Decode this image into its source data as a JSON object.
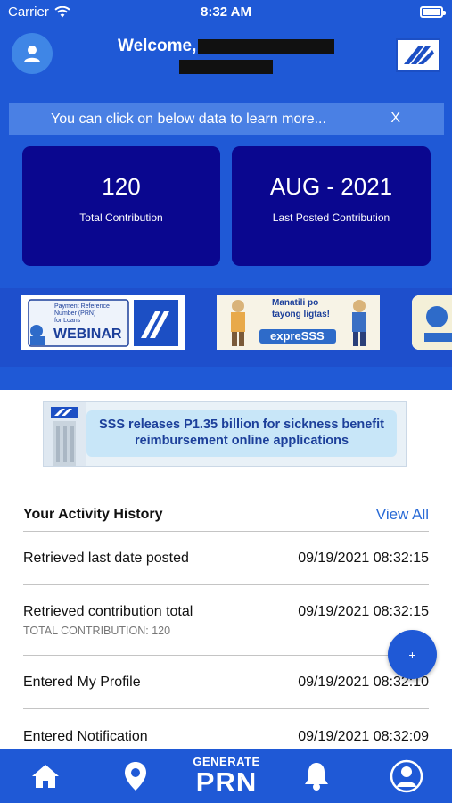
{
  "status": {
    "carrier": "Carrier",
    "time": "8:32 AM"
  },
  "header": {
    "welcome": "Welcome,"
  },
  "info_bar": {
    "message": "You can click on below data to learn more...",
    "close": "X"
  },
  "cards": [
    {
      "value": "120",
      "label": "Total Contribution"
    },
    {
      "value": "AUG - 2021",
      "label": "Last Posted Contribution"
    }
  ],
  "banners": {
    "b1": {
      "line1": "Payment Reference",
      "line2": "Number (PRN)",
      "line3": "for Loans",
      "title": "WEBINAR"
    },
    "b2": {
      "line1": "Manatili po",
      "line2": "tayong ligtas!",
      "brand": "expreSSS"
    }
  },
  "news": {
    "line1": "SSS releases P1.35 billion for sickness benefit",
    "line2": "reimbursement online applications"
  },
  "history": {
    "title": "Your Activity History",
    "view_all": "View All",
    "items": [
      {
        "name": "Retrieved last date posted",
        "timestamp": "09/19/2021 08:32:15",
        "sub": ""
      },
      {
        "name": "Retrieved contribution total",
        "timestamp": "09/19/2021 08:32:15",
        "sub": "TOTAL CONTRIBUTION: 120"
      },
      {
        "name": "Entered My Profile",
        "timestamp": "09/19/2021 08:32:10",
        "sub": ""
      },
      {
        "name": "Entered Notification",
        "timestamp": "09/19/2021 08:32:09",
        "sub": ""
      }
    ]
  },
  "fab": {
    "label": "+"
  },
  "tabbar": {
    "prn_line1": "GENERATE",
    "prn_line2": "PRN"
  },
  "icons": [
    "wifi-icon",
    "battery-icon",
    "user-icon",
    "sss-logo-icon",
    "home-icon",
    "location-pin-icon",
    "bell-icon",
    "profile-icon"
  ],
  "colors": {
    "primary": "#1f59d6",
    "card": "#0a078f",
    "link": "#2a6bd6"
  }
}
